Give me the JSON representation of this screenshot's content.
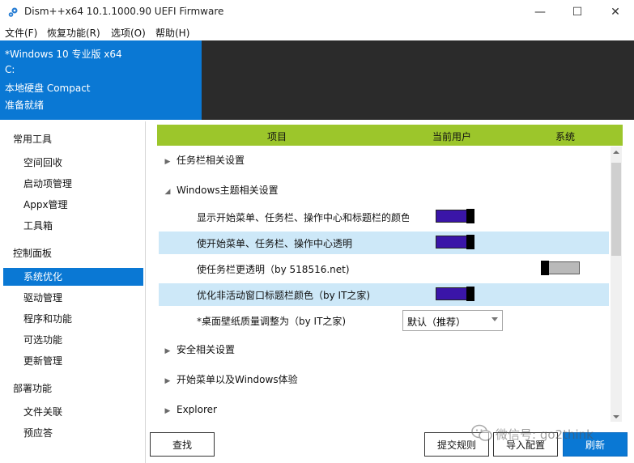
{
  "window": {
    "title": "Dism++x64 10.1.1000.90 UEFI Firmware",
    "min_glyph": "—",
    "max_glyph": "☐",
    "close_glyph": "✕"
  },
  "menu": [
    "文件(F)",
    "恢复功能(R)",
    "选项(O)",
    "帮助(H)"
  ],
  "info": {
    "os": "*Windows 10 专业版 x64",
    "drive": "C:",
    "disk": "本地硬盘 Compact",
    "status": "准备就绪"
  },
  "sidebar": {
    "group1_header": "常用工具",
    "group1_items": [
      "空间回收",
      "启动项管理",
      "Appx管理",
      "工具箱"
    ],
    "group2_header": "控制面板",
    "group2_items": [
      "系统优化",
      "驱动管理",
      "程序和功能",
      "可选功能",
      "更新管理"
    ],
    "group3_header": "部署功能",
    "group3_items": [
      "文件关联",
      "预应答"
    ],
    "active_item": "系统优化"
  },
  "table": {
    "col_item": "项目",
    "col_current_user": "当前用户",
    "col_system": "系统"
  },
  "categories": {
    "taskbar": "任务栏相关设置",
    "theme": "Windows主题相关设置",
    "security": "安全相关设置",
    "startmenu": "开始菜单以及Windows体验",
    "explorer": "Explorer"
  },
  "settings": [
    {
      "label": "显示开始菜单、任务栏、操作中心和标题栏的颜色",
      "current_user": "on"
    },
    {
      "label": "使开始菜单、任务栏、操作中心透明",
      "current_user": "on"
    },
    {
      "label": "使任务栏更透明（by 518516.net)",
      "system": "off"
    },
    {
      "label": "优化非活动窗口标题栏颜色（by IT之家)",
      "current_user": "on"
    },
    {
      "label": "*桌面壁纸质量调整为（by IT之家)",
      "select_value": "默认（推荐）"
    }
  ],
  "buttons": {
    "find": "查找",
    "submit_rules": "提交规则",
    "import_config": "导入配置",
    "refresh": "刷新"
  },
  "watermark": "微信号: go2think",
  "colors": {
    "accent": "#0a78d4",
    "header_green": "#9cc62b",
    "toggle_on": "#3a15a8",
    "row_highlight": "#cde8f8"
  }
}
